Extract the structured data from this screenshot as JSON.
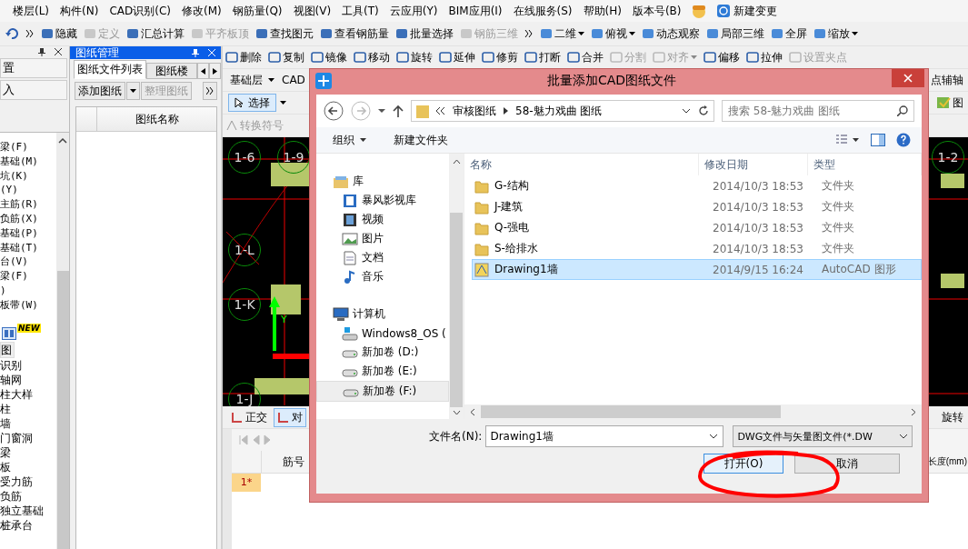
{
  "menu": {
    "items": [
      "楼层(L)",
      "构件(N)",
      "CAD识别(C)",
      "修改(M)",
      "钢筋量(Q)",
      "视图(V)",
      "工具(T)",
      "云应用(Y)",
      "BIM应用(I)",
      "在线服务(S)",
      "帮助(H)",
      "版本号(B)"
    ],
    "extra": "新建变更"
  },
  "main_toolbar": {
    "tools": [
      {
        "label": "隐藏",
        "disabled": false
      },
      {
        "label": "定义",
        "disabled": true
      },
      {
        "label": "汇总计算",
        "disabled": false
      },
      {
        "label": "平齐板顶",
        "disabled": true
      },
      {
        "label": "查找图元",
        "disabled": false
      },
      {
        "label": "查看钢筋量",
        "disabled": false
      },
      {
        "label": "批量选择",
        "disabled": false
      },
      {
        "label": "钢筋三维",
        "disabled": true
      }
    ],
    "view_tools": [
      {
        "label": "二维",
        "dropdown": true
      },
      {
        "label": "俯视",
        "dropdown": true
      },
      {
        "label": "动态观察",
        "dropdown": false
      },
      {
        "label": "局部三维",
        "dropdown": false
      },
      {
        "label": "全屏",
        "dropdown": false
      },
      {
        "label": "缩放",
        "dropdown": true
      }
    ]
  },
  "left_nav": {
    "buttons": [
      "置",
      "入"
    ],
    "items": [
      "梁(F)",
      "基础(M)",
      "坑(K)",
      "(Y)",
      "主筋(R)",
      "负筋(X)",
      "基础(P)",
      "基础(T)",
      "台(V)",
      "梁(F)",
      ")",
      "板带(W)"
    ],
    "new_badge": "NEW",
    "tools": [
      "图",
      "识别",
      "轴网",
      "柱大样",
      "柱",
      "墙",
      "门窗洞",
      "梁",
      "板",
      "受力筋",
      "负筋",
      "独立基础",
      "桩承台"
    ]
  },
  "drawing_panel": {
    "title": "图纸管理",
    "tabs": [
      {
        "label": "图纸文件列表",
        "selected": true
      },
      {
        "label": "图纸楼",
        "selected": false
      }
    ],
    "add_button": "添加图纸",
    "organize_button": {
      "label": "整理图纸",
      "disabled": true
    },
    "column": "图纸名称"
  },
  "edit_toolbar": [
    {
      "label": "删除",
      "disabled": false,
      "dropdown": false
    },
    {
      "label": "复制",
      "disabled": false,
      "dropdown": false
    },
    {
      "label": "镜像",
      "disabled": false,
      "dropdown": false
    },
    {
      "label": "移动",
      "disabled": false,
      "dropdown": false
    },
    {
      "label": "旋转",
      "disabled": false,
      "dropdown": false
    },
    {
      "label": "延伸",
      "disabled": false,
      "dropdown": false
    },
    {
      "label": "修剪",
      "disabled": false,
      "dropdown": false
    },
    {
      "label": "打断",
      "disabled": false,
      "dropdown": false
    },
    {
      "label": "合并",
      "disabled": false,
      "dropdown": false
    },
    {
      "label": "分割",
      "disabled": true,
      "dropdown": false
    },
    {
      "label": "对齐",
      "disabled": true,
      "dropdown": true
    },
    {
      "label": "偏移",
      "disabled": false,
      "dropdown": false
    },
    {
      "label": "拉伸",
      "disabled": false,
      "dropdown": false
    },
    {
      "label": "设置夹点",
      "disabled": true,
      "dropdown": false
    }
  ],
  "floor_select": "基础层",
  "cad_label": "CAD",
  "axis_tool": "点辅轴",
  "select_button": "选择",
  "layer_tool": "图",
  "symbol_button": "转换符号",
  "canvas": {
    "labels": [
      "1-6",
      "1-9",
      "1-L",
      "1-K",
      "1-J",
      "1-2"
    ],
    "axis_label": "Y"
  },
  "bottom_toolbar": {
    "tools": [
      "正交",
      "对"
    ],
    "right_tool": "旋转"
  },
  "rebar_table": {
    "columns": [
      "筋号",
      "长度(mm)"
    ],
    "row_number": "1*"
  },
  "dialog": {
    "title": "批量添加CAD图纸文件",
    "breadcrumb": [
      "审核图纸",
      "58-魅力戏曲 图纸"
    ],
    "search_placeholder": "搜索 58-魅力戏曲 图纸",
    "organize": "组织",
    "new_folder": "新建文件夹",
    "nav": [
      {
        "label": "库",
        "kind": "group",
        "selected": false
      },
      {
        "label": "暴风影视库",
        "kind": "library",
        "selected": false
      },
      {
        "label": "视频",
        "kind": "video",
        "selected": false
      },
      {
        "label": "图片",
        "kind": "picture",
        "selected": false
      },
      {
        "label": "文档",
        "kind": "document",
        "selected": false
      },
      {
        "label": "音乐",
        "kind": "music",
        "selected": false
      },
      {
        "label": "计算机",
        "kind": "computer",
        "selected": false
      },
      {
        "label": "Windows8_OS (",
        "kind": "system-drive",
        "selected": false
      },
      {
        "label": "新加卷 (D:)",
        "kind": "drive",
        "selected": false
      },
      {
        "label": "新加卷 (E:)",
        "kind": "drive",
        "selected": false
      },
      {
        "label": "新加卷 (F:)",
        "kind": "drive",
        "selected": true
      }
    ],
    "columns": [
      "名称",
      "修改日期",
      "类型"
    ],
    "files": [
      {
        "name": "G-结构",
        "date": "2014/10/3 18:53",
        "type": "文件夹",
        "kind": "folder",
        "selected": false
      },
      {
        "name": "J-建筑",
        "date": "2014/10/3 18:53",
        "type": "文件夹",
        "kind": "folder",
        "selected": false
      },
      {
        "name": "Q-强电",
        "date": "2014/10/3 18:53",
        "type": "文件夹",
        "kind": "folder",
        "selected": false
      },
      {
        "name": "S-给排水",
        "date": "2014/10/3 18:53",
        "type": "文件夹",
        "kind": "folder",
        "selected": false
      },
      {
        "name": "Drawing1墙",
        "date": "2014/9/15 16:24",
        "type": "AutoCAD 图形",
        "kind": "cad",
        "selected": true
      }
    ],
    "filename_label": "文件名(N):",
    "filename": "Drawing1墙",
    "filter": "DWG文件与矢量图文件(*.DW",
    "open_button": "打开(O)",
    "cancel_button": "取消"
  }
}
